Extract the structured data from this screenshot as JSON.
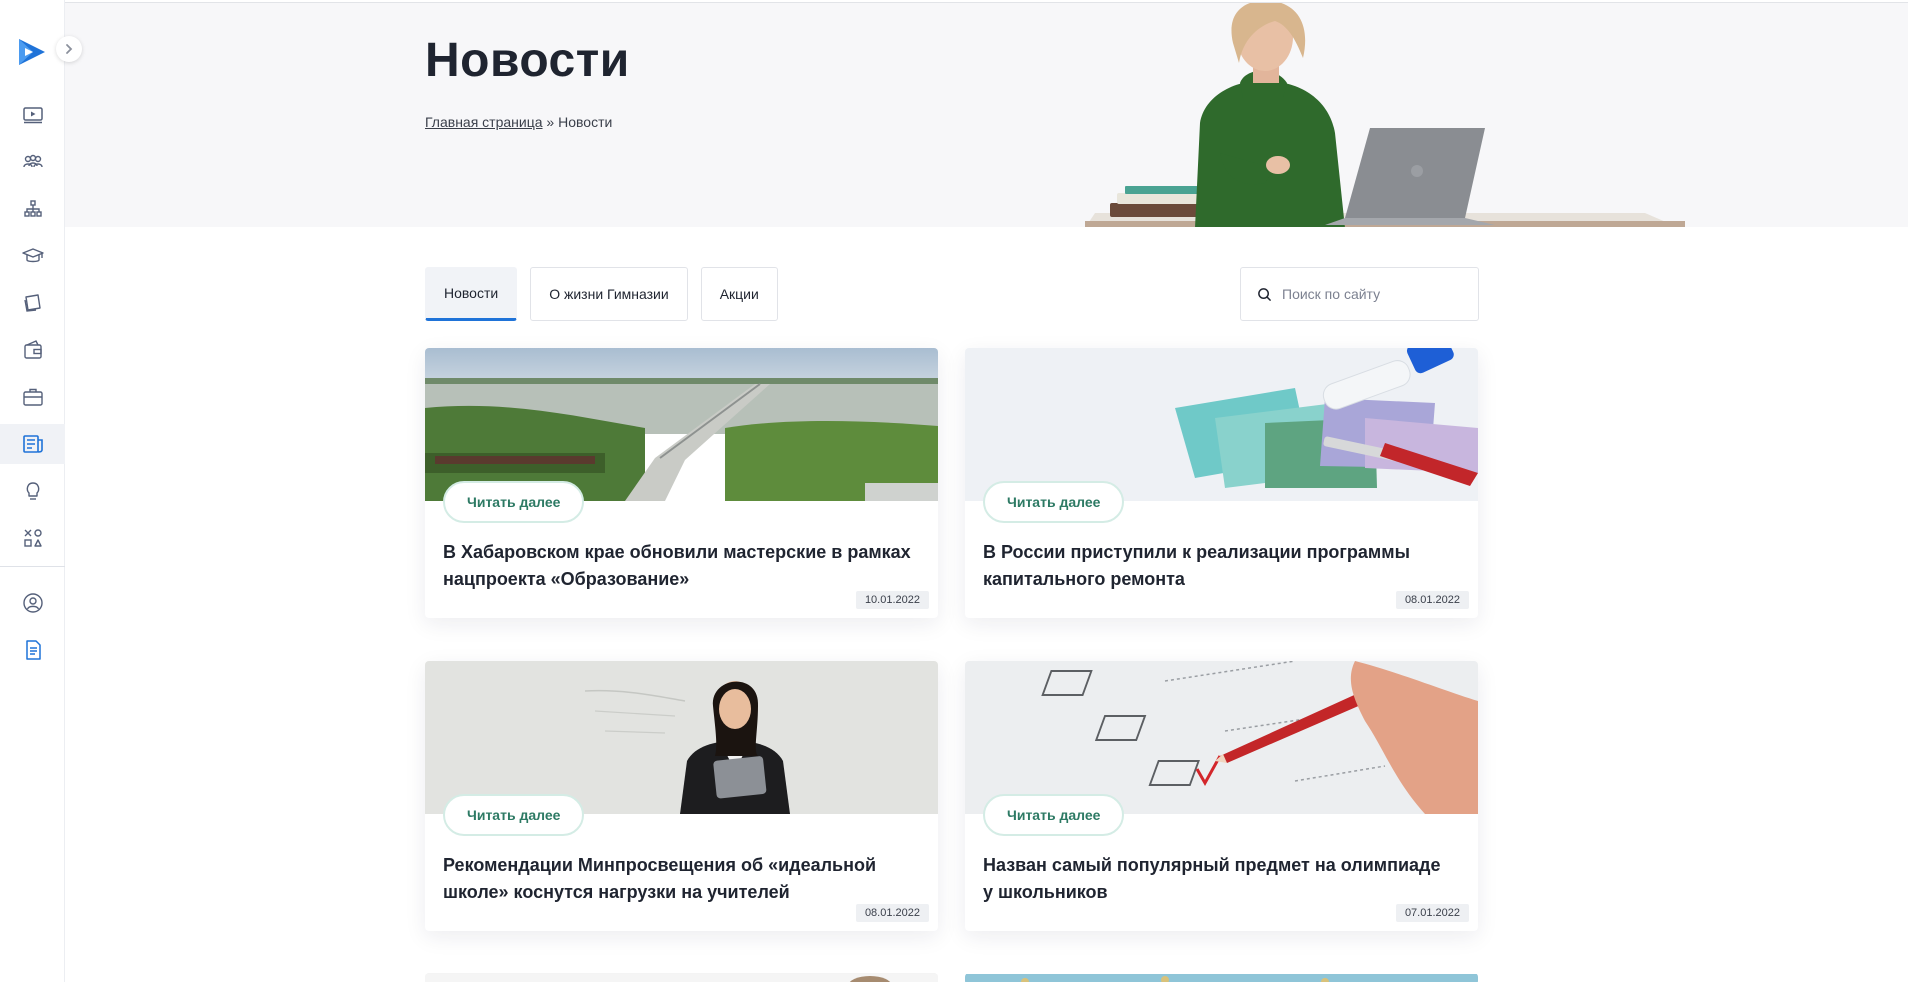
{
  "sidebar": {
    "items": [
      {
        "icon": "video-lesson-icon",
        "active": false
      },
      {
        "icon": "community-icon",
        "active": false
      },
      {
        "icon": "hierarchy-icon",
        "active": false
      },
      {
        "icon": "graduation-cap-icon",
        "active": false
      },
      {
        "icon": "cards-icon",
        "active": false
      },
      {
        "icon": "wallet-icon",
        "active": false
      },
      {
        "icon": "briefcase-icon",
        "active": false
      },
      {
        "icon": "news-icon",
        "active": true
      },
      {
        "icon": "lightbulb-icon",
        "active": false
      },
      {
        "icon": "tools-icon",
        "active": false
      }
    ],
    "bottom_items": [
      {
        "icon": "profile-icon"
      },
      {
        "icon": "document-icon"
      }
    ],
    "accent": "#1f73d8"
  },
  "header": {
    "title": "Новости",
    "breadcrumb_home": "Главная страница",
    "breadcrumb_sep": "»",
    "breadcrumb_current": "Новости"
  },
  "tabs": [
    {
      "label": "Новости",
      "active": true
    },
    {
      "label": "О жизни Гимназии",
      "active": false
    },
    {
      "label": "Акции",
      "active": false
    }
  ],
  "search": {
    "placeholder": "Поиск по сайту"
  },
  "cards": [
    {
      "title": "В Хабаровском крае обновили мастерские в рамках нацпроекта «Образование»",
      "date": "10.01.2022",
      "button": "Читать далее"
    },
    {
      "title": "В России приступили к реализации программы капитального ремонта",
      "date": "08.01.2022",
      "button": "Читать далее"
    },
    {
      "title": "Рекомендации Минпросвещения об «идеальной школе» коснутся нагрузки на учителей",
      "date": "08.01.2022",
      "button": "Читать далее"
    },
    {
      "title": "Назван самый популярный предмет на олимпиаде у школьников",
      "date": "07.01.2022",
      "button": "Читать далее"
    }
  ]
}
